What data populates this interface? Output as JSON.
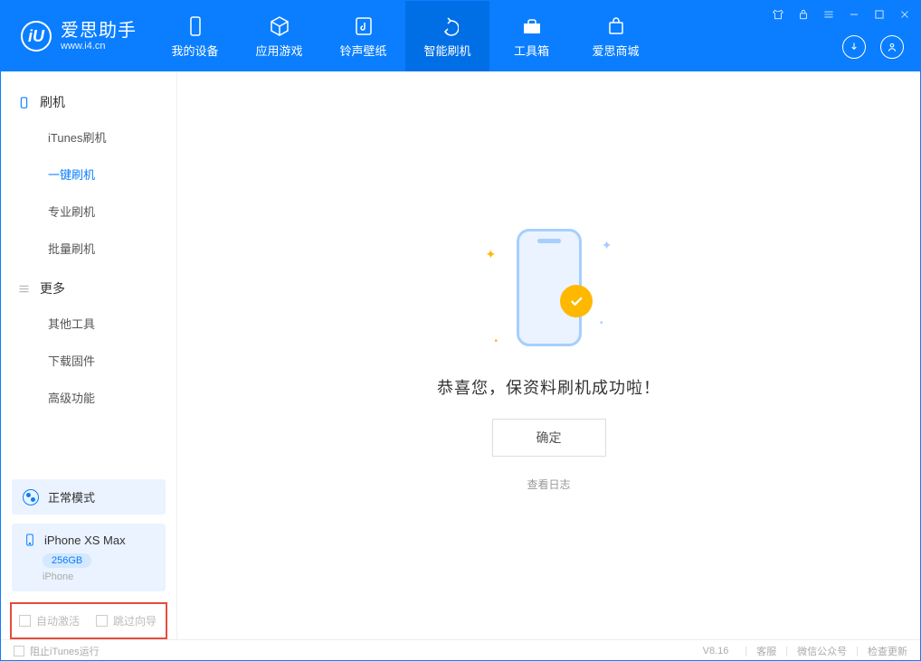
{
  "logo": {
    "title": "爱思助手",
    "subtitle": "www.i4.cn",
    "glyph": "iU"
  },
  "nav": [
    {
      "label": "我的设备",
      "icon": "device"
    },
    {
      "label": "应用游戏",
      "icon": "cube"
    },
    {
      "label": "铃声壁纸",
      "icon": "music"
    },
    {
      "label": "智能刷机",
      "icon": "refresh"
    },
    {
      "label": "工具箱",
      "icon": "toolbox"
    },
    {
      "label": "爱思商城",
      "icon": "store"
    }
  ],
  "sidebar": {
    "flash_header": "刷机",
    "flash_items": [
      "iTunes刷机",
      "一键刷机",
      "专业刷机",
      "批量刷机"
    ],
    "more_header": "更多",
    "more_items": [
      "其他工具",
      "下载固件",
      "高级功能"
    ]
  },
  "mode": {
    "label": "正常模式"
  },
  "device": {
    "name": "iPhone XS Max",
    "storage": "256GB",
    "type": "iPhone"
  },
  "checkboxes": {
    "auto_activate": "自动激活",
    "skip_guide": "跳过向导"
  },
  "main": {
    "success_text": "恭喜您，保资料刷机成功啦！",
    "confirm_label": "确定",
    "log_link": "查看日志"
  },
  "footer": {
    "block_itunes": "阻止iTunes运行",
    "version": "V8.16",
    "links": [
      "客服",
      "微信公众号",
      "检查更新"
    ]
  }
}
